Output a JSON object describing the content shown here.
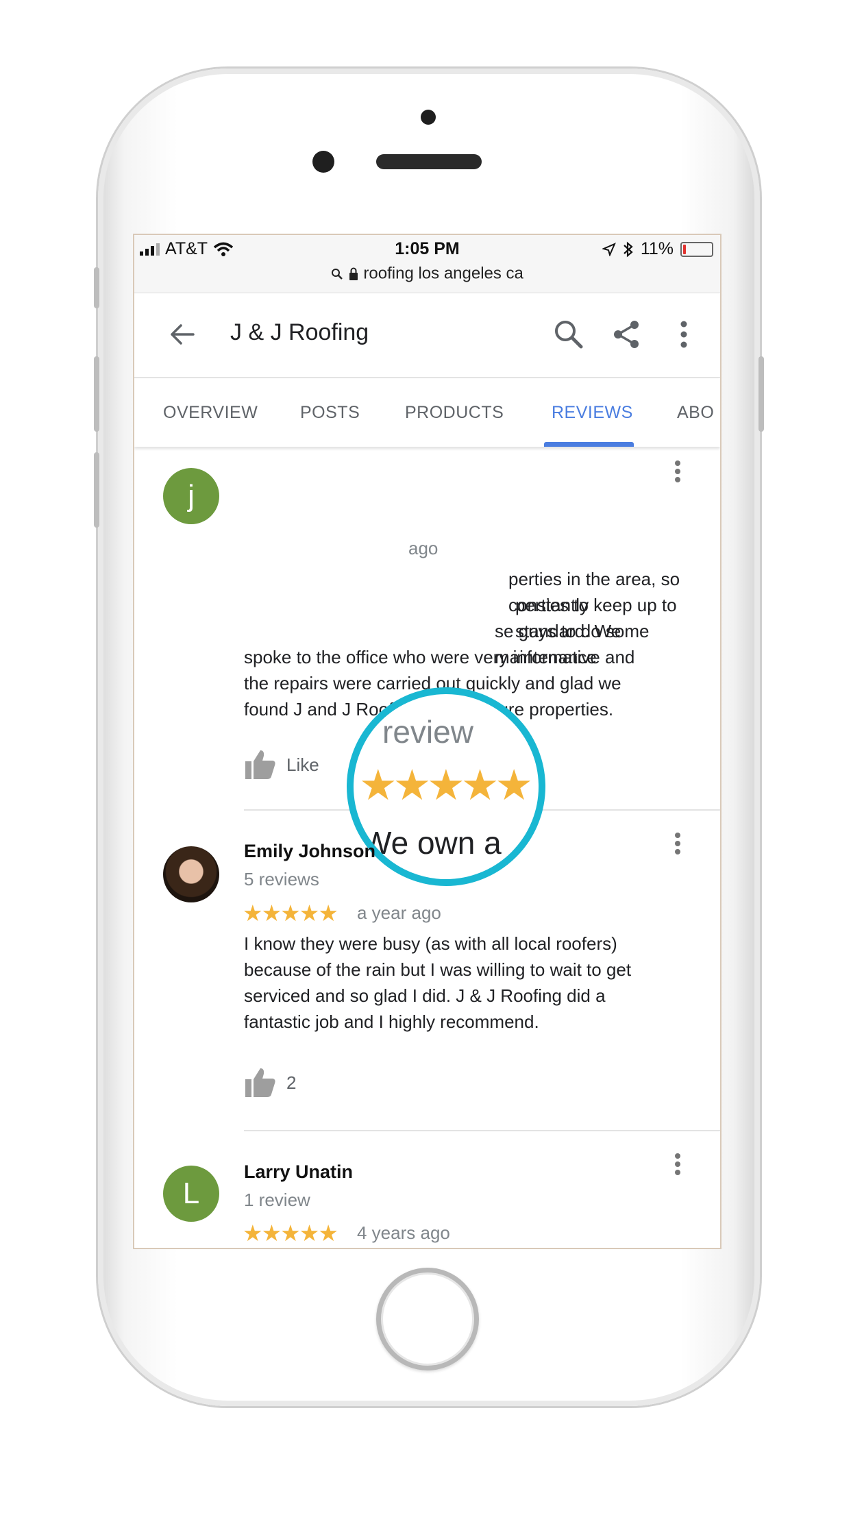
{
  "status_bar": {
    "carrier": "AT&T",
    "time": "1:05 PM",
    "battery": "11%",
    "battery_level": 0.11,
    "url": "roofing los angeles ca"
  },
  "app_bar": {
    "title": "J & J Roofing",
    "icons": [
      "back-arrow-icon",
      "search-icon",
      "share-icon",
      "more-vert-icon"
    ]
  },
  "tabs": [
    {
      "label": "OVERVIEW",
      "active": false
    },
    {
      "label": "POSTS",
      "active": false
    },
    {
      "label": "PRODUCTS",
      "active": false
    },
    {
      "label": "REVIEWS",
      "active": true
    },
    {
      "label": "ABO",
      "active": false
    }
  ],
  "accent_color": "#4a7de0",
  "star_color": "#f4b43a",
  "magnifier": {
    "title": "review",
    "stars": "★★★★★",
    "text": "We own a"
  },
  "reviews": [
    {
      "avatar_letter": "j",
      "time": "ago",
      "text_lines": [
        "perties in the area, so constantly",
        "perties to keep up to standard. We",
        "se guys to do some maintenance",
        "spoke to the office who were very informative and",
        "the repairs were carried out quickly and glad we",
        "found J and J Roofing for our future properties."
      ],
      "like_label": "Like"
    },
    {
      "name": "Emily Johnson",
      "review_count": "5 reviews",
      "stars": "★★★★★",
      "rating": 5,
      "time": "a year ago",
      "text_lines": [
        "I know they were busy (as with all local roofers)",
        "because of the rain but I was willing to wait to get",
        "serviced and so glad I did.  J & J Roofing did a",
        "fantastic job and I highly recommend."
      ],
      "like_count": "2"
    },
    {
      "avatar_letter": "L",
      "name": "Larry Unatin",
      "review_count": "1 review",
      "stars": "★★★★★",
      "rating": 5,
      "time": "4 years ago"
    }
  ]
}
